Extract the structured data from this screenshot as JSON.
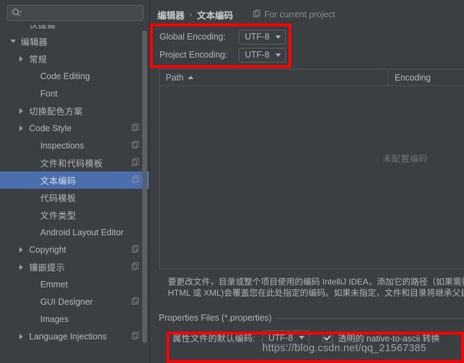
{
  "search": {
    "placeholder": "",
    "value": "",
    "icon": "search-icon"
  },
  "sidebar": {
    "scrollbar": "vertical-scrollbar",
    "items": [
      {
        "label": "快捷键",
        "indent": 1,
        "arrow": "none",
        "copy": false,
        "selected": false,
        "cjk": true
      },
      {
        "label": "编辑器",
        "indent": 0,
        "arrow": "down",
        "copy": false,
        "selected": false,
        "cjk": true
      },
      {
        "label": "常规",
        "indent": 1,
        "arrow": "right",
        "copy": false,
        "selected": false,
        "cjk": true
      },
      {
        "label": "Code Editing",
        "indent": 2,
        "arrow": "none",
        "copy": false,
        "selected": false,
        "cjk": false
      },
      {
        "label": "Font",
        "indent": 2,
        "arrow": "none",
        "copy": false,
        "selected": false,
        "cjk": false
      },
      {
        "label": "切换配色方案",
        "indent": 1,
        "arrow": "right",
        "copy": false,
        "selected": false,
        "cjk": true
      },
      {
        "label": "Code Style",
        "indent": 1,
        "arrow": "right",
        "copy": true,
        "selected": false,
        "cjk": false
      },
      {
        "label": "Inspections",
        "indent": 2,
        "arrow": "none",
        "copy": true,
        "selected": false,
        "cjk": false
      },
      {
        "label": "文件和代码模板",
        "indent": 2,
        "arrow": "none",
        "copy": true,
        "selected": false,
        "cjk": true
      },
      {
        "label": "文本编码",
        "indent": 2,
        "arrow": "none",
        "copy": true,
        "selected": true,
        "cjk": true
      },
      {
        "label": "代码模板",
        "indent": 2,
        "arrow": "none",
        "copy": false,
        "selected": false,
        "cjk": true
      },
      {
        "label": "文件类型",
        "indent": 2,
        "arrow": "none",
        "copy": false,
        "selected": false,
        "cjk": true
      },
      {
        "label": "Android Layout Editor",
        "indent": 2,
        "arrow": "none",
        "copy": false,
        "selected": false,
        "cjk": false
      },
      {
        "label": "Copyright",
        "indent": 1,
        "arrow": "right",
        "copy": true,
        "selected": false,
        "cjk": false
      },
      {
        "label": "镶嵌提示",
        "indent": 1,
        "arrow": "right",
        "copy": true,
        "selected": false,
        "cjk": true
      },
      {
        "label": "Emmet",
        "indent": 2,
        "arrow": "none",
        "copy": false,
        "selected": false,
        "cjk": false
      },
      {
        "label": "GUI Designer",
        "indent": 2,
        "arrow": "none",
        "copy": true,
        "selected": false,
        "cjk": false
      },
      {
        "label": "Images",
        "indent": 2,
        "arrow": "none",
        "copy": false,
        "selected": false,
        "cjk": false
      },
      {
        "label": "Language Injections",
        "indent": 1,
        "arrow": "right",
        "copy": true,
        "selected": false,
        "cjk": false
      }
    ]
  },
  "main": {
    "breadcrumb": {
      "parent": "编辑器",
      "separator": "›",
      "current": "文本编码"
    },
    "scope": {
      "label": "For current project",
      "icon": "copy-icon"
    },
    "encodings": [
      {
        "label": "Global Encoding:",
        "value": "UTF-8"
      },
      {
        "label": "Project Encoding:",
        "value": "UTF-8"
      }
    ],
    "table": {
      "columns": [
        "Path",
        "Encoding"
      ],
      "sort_column": "Path",
      "sort_direction": "ascending",
      "rows": [],
      "empty_text": "未配置编码"
    },
    "description_line1": "要更改文件，目录或整个项目使用的编码 IntelliJ IDEA，添加它的路径（如果需要），然",
    "description_line2": "HTML 或 XML)会覆盖您在此处指定的编码。如果未指定，文件和目录将继承父目录或",
    "properties": {
      "group_label": "Properties Files (*.properties)",
      "default_encoding_label": "属性文件的默认编码:",
      "default_encoding_value": "UTF-8",
      "transparent_checkbox_label": "透明的 native-to-ascii 转换",
      "transparent_checkbox_checked": true
    }
  },
  "watermark": "https://blog.csdn.net/qq_21567385",
  "colors": {
    "background": "#3C3F41",
    "selection": "#4B6EAF",
    "text": "#B4B7BA",
    "muted": "#6F7375",
    "border": "#4E5254",
    "annotation": "#FF0000"
  }
}
